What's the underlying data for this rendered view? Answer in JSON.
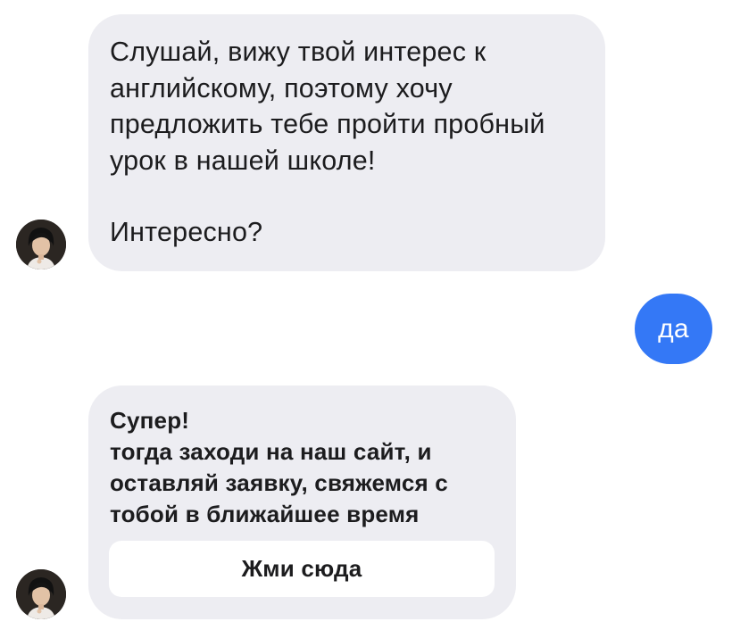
{
  "messages": {
    "incoming_1": {
      "lines": [
        "Слушай, вижу твой интерес к",
        "английскому, поэтому хочу",
        "предложить тебе пройти пробный",
        "урок в нашей школе!"
      ],
      "question": "Интересно?"
    },
    "outgoing_1": {
      "text": "да"
    },
    "incoming_2": {
      "lines": [
        "Супер!",
        "тогда заходи на наш сайт, и",
        "оставляй заявку, свяжемся с",
        "тобой в ближайшее время"
      ],
      "button_label": "Жми сюда"
    }
  },
  "colors": {
    "incoming_bubble": "#ededf2",
    "outgoing_bubble": "#3478f6",
    "text": "#1c1c1e"
  },
  "icons": {
    "avatar": "sender-avatar-photo"
  }
}
